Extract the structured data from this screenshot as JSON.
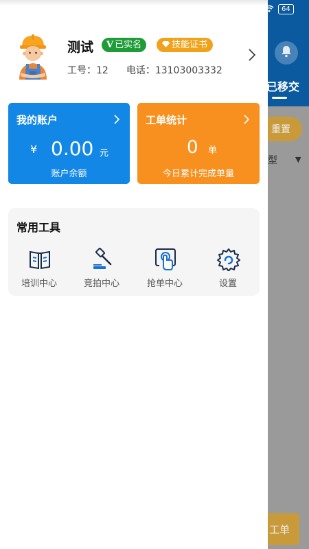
{
  "background_app": {
    "status": {
      "battery": "64"
    },
    "tab_label": "已移交",
    "reset_label": "重置",
    "type_label": "型",
    "bottom_button_label": "工单"
  },
  "profile": {
    "name": "测试",
    "verified_badge": "已实名",
    "verified_mark": "V",
    "cert_badge": "技能证书",
    "employee_no_label": "工号：12",
    "phone_label": "电话：13103003332"
  },
  "account_card": {
    "title": "我的账户",
    "currency": "¥",
    "amount": "0.00",
    "unit": "元",
    "caption": "账户余额"
  },
  "orders_card": {
    "title": "工单统计",
    "count": "0",
    "unit": "单",
    "caption": "今日累计完成单量"
  },
  "tools": {
    "title": "常用工具",
    "items": [
      {
        "label": "培训中心",
        "icon": "book-icon"
      },
      {
        "label": "竞拍中心",
        "icon": "gavel-icon"
      },
      {
        "label": "抢单中心",
        "icon": "tap-icon"
      },
      {
        "label": "设置",
        "icon": "gear-icon"
      }
    ]
  },
  "colors": {
    "account_blue": "#1387e6",
    "orders_orange": "#f7901e",
    "verified_green": "#1e9c38",
    "cert_orange": "#f0a21a",
    "header_blue": "#0b5aa0"
  }
}
